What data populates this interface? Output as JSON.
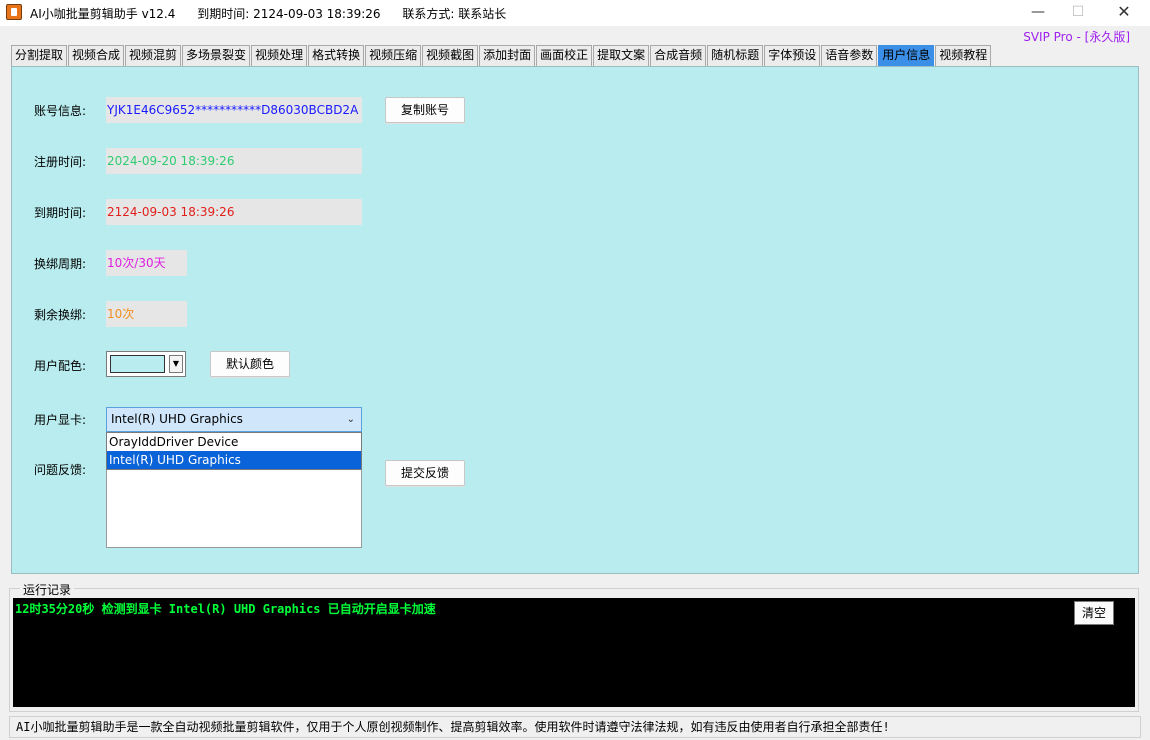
{
  "window": {
    "title": "AI小咖批量剪辑助手 v12.4",
    "expire_label": "到期时间:",
    "expire_value": "2124-09-03 18:39:26",
    "contact_label": "联系方式:",
    "contact_value": "联系站长",
    "min_icon": "—",
    "max_icon": "☐",
    "close_icon": "✕"
  },
  "edition": "SVIP Pro - [永久版]",
  "tabs": [
    "分割提取",
    "视频合成",
    "视频混剪",
    "多场景裂变",
    "视频处理",
    "格式转换",
    "视频压缩",
    "视频截图",
    "添加封面",
    "画面校正",
    "提取文案",
    "合成音频",
    "随机标题",
    "字体预设",
    "语音参数",
    "用户信息",
    "视频教程"
  ],
  "active_tab": "用户信息",
  "user": {
    "account_label": "账号信息:",
    "account_value": "YJK1E46C9652***********D86030BCBD2A",
    "copy_button": "复制账号",
    "register_label": "注册时间:",
    "register_value": "2024-09-20 18:39:26",
    "expire_label": "到期时间:",
    "expire_value": "2124-09-03 18:39:26",
    "rebind_cycle_label": "换绑周期:",
    "rebind_cycle_value": "10次/30天",
    "rebind_left_label": "剩余换绑:",
    "rebind_left_value": "10次",
    "color_label": "用户配色:",
    "color_value": "#b9ecee",
    "default_color_button": "默认颜色",
    "gpu_label": "用户显卡:",
    "gpu_selected": "Intel(R) UHD Graphics",
    "gpu_options": [
      "OrayIddDriver Device",
      "Intel(R) UHD Graphics"
    ],
    "feedback_label": "问题反馈:",
    "feedback_value": "",
    "submit_button": "提交反馈"
  },
  "log": {
    "legend": "运行记录",
    "lines": [
      "12时35分20秒 检测到显卡 Intel(R) UHD Graphics 已自动开启显卡加速"
    ],
    "clear_button": "清空"
  },
  "status_text": "AI小咖批量剪辑助手是一款全自动视频批量剪辑软件，仅用于个人原创视频制作、提高剪辑效率。使用软件时请遵守法律法规，如有违反由使用者自行承担全部责任!",
  "colors": {
    "panel_bg": "#b9ecee",
    "active_tab": "#3c8fe6",
    "account_text": "#1a1aff",
    "register_text": "#2ecc71",
    "expire_text": "#e0201b",
    "cycle_text": "#e020e0",
    "left_text": "#f0901e",
    "log_text": "#00ff3a"
  }
}
